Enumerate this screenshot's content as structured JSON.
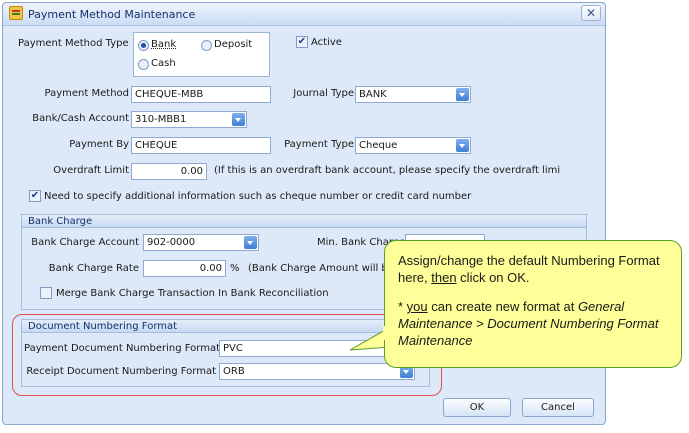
{
  "window": {
    "title": "Payment Method Maintenance",
    "close_glyph": "✕"
  },
  "form": {
    "payment_method_type_label": "Payment Method Type",
    "radio_bank": "Bank",
    "radio_deposit": "Deposit",
    "radio_cash": "Cash",
    "active_label": "Active",
    "payment_method_label": "Payment Method",
    "payment_method_value": "CHEQUE-MBB",
    "journal_type_label": "Journal Type",
    "journal_type_value": "BANK",
    "bank_cash_account_label": "Bank/Cash Account",
    "bank_cash_account_value": "310-MBB1",
    "payment_by_label": "Payment By",
    "payment_by_value": "CHEQUE",
    "payment_type_label": "Payment Type",
    "payment_type_value": "Cheque",
    "overdraft_limit_label": "Overdraft Limit",
    "overdraft_limit_value": "0.00",
    "overdraft_hint": "(If this is an overdraft bank account, please specify the overdraft limi",
    "additional_info_label": "Need to specify additional information such as cheque number or credit card number"
  },
  "bank_charge": {
    "header": "Bank Charge",
    "account_label": "Bank Charge Account",
    "account_value": "902-0000",
    "min_label": "Min. Bank Charge",
    "rate_label": "Bank Charge Rate",
    "rate_value": "0.00",
    "rate_unit": "%",
    "amount_hint": "(Bank Charge Amount will be a",
    "merge_label": "Merge Bank Charge Transaction In Bank Reconciliation"
  },
  "numbering": {
    "header": "Document Numbering Format",
    "payment_label": "Payment Document Numbering Format",
    "payment_value": "PVC",
    "receipt_label": "Receipt Document Numbering Format",
    "receipt_value": "ORB"
  },
  "buttons": {
    "ok": "OK",
    "cancel": "Cancel"
  },
  "callout": {
    "line1_a": "Assign/change the default Numbering Format here, ",
    "line1_b": "then",
    "line1_c": " click on OK.",
    "line2_a": "* ",
    "line2_b": "you",
    "line2_c": " can create new format at ",
    "line2_d": "General Maintenance > Document Numbering Format Maintenance"
  }
}
